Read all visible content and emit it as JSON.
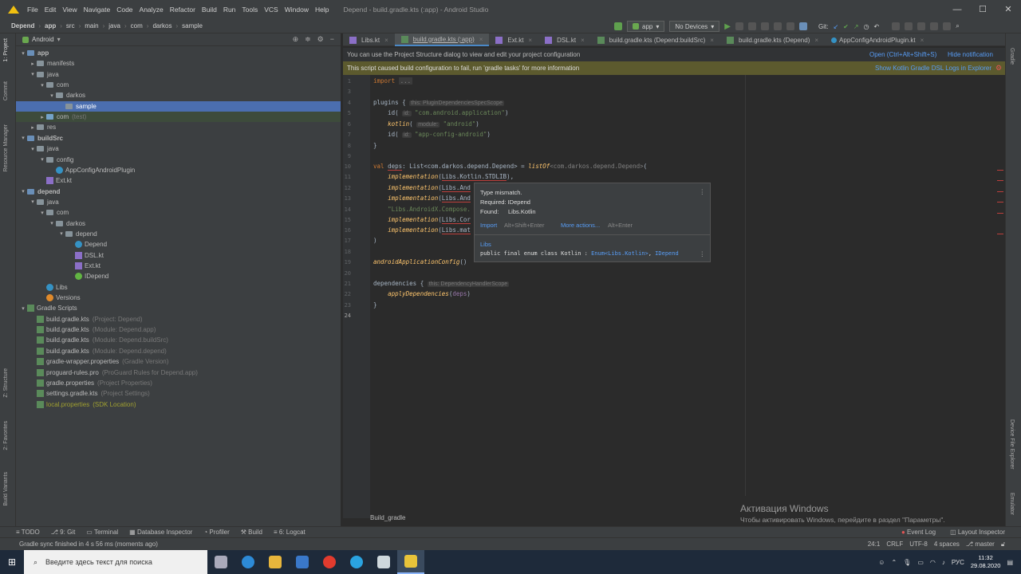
{
  "window": {
    "title": "Depend - build.gradle.kts (:app) - Android Studio",
    "menu": [
      "File",
      "Edit",
      "View",
      "Navigate",
      "Code",
      "Analyze",
      "Refactor",
      "Build",
      "Run",
      "Tools",
      "VCS",
      "Window",
      "Help"
    ],
    "controls": {
      "minimize": "—",
      "maximize": "☐",
      "close": "✕"
    }
  },
  "breadcrumb": [
    "Depend",
    "app",
    "src",
    "main",
    "java",
    "com",
    "darkos",
    "sample"
  ],
  "toolbar": {
    "run_config": "app",
    "device": "No Devices",
    "git_label": "Git:"
  },
  "project_panel": {
    "view_label": "Android",
    "tree": [
      {
        "label": "app",
        "dim": "",
        "kind": "module",
        "bold": true
      },
      {
        "label": "manifests",
        "dim": "",
        "kind": "folder"
      },
      {
        "label": "java",
        "dim": "",
        "kind": "folder"
      },
      {
        "label": "com",
        "dim": "",
        "kind": "folder"
      },
      {
        "label": "darkos",
        "dim": "",
        "kind": "folder"
      },
      {
        "label": "sample",
        "dim": "",
        "kind": "folder"
      },
      {
        "label": "com",
        "dim": "(test)",
        "kind": "folder"
      },
      {
        "label": "res",
        "dim": "",
        "kind": "folder"
      },
      {
        "label": "buildSrc",
        "dim": "",
        "kind": "module",
        "bold": true
      },
      {
        "label": "java",
        "dim": "",
        "kind": "folder"
      },
      {
        "label": "config",
        "dim": "",
        "kind": "folder"
      },
      {
        "label": "AppConfigAndroidPlugin",
        "dim": "",
        "kind": "class"
      },
      {
        "label": "Ext.kt",
        "dim": "",
        "kind": "kt"
      },
      {
        "label": "depend",
        "dim": "",
        "kind": "module",
        "bold": true
      },
      {
        "label": "java",
        "dim": "",
        "kind": "folder"
      },
      {
        "label": "com",
        "dim": "",
        "kind": "folder"
      },
      {
        "label": "darkos",
        "dim": "",
        "kind": "folder"
      },
      {
        "label": "depend",
        "dim": "",
        "kind": "folder"
      },
      {
        "label": "Depend",
        "dim": "",
        "kind": "class"
      },
      {
        "label": "DSL.kt",
        "dim": "",
        "kind": "kt"
      },
      {
        "label": "Ext.kt",
        "dim": "",
        "kind": "kt"
      },
      {
        "label": "IDepend",
        "dim": "",
        "kind": "interface"
      },
      {
        "label": "Libs",
        "dim": "",
        "kind": "class"
      },
      {
        "label": "Versions",
        "dim": "",
        "kind": "object"
      },
      {
        "label": "Gradle Scripts",
        "dim": "",
        "kind": "gradle-root"
      },
      {
        "label": "build.gradle.kts",
        "dim": "(Project: Depend)",
        "kind": "gradle"
      },
      {
        "label": "build.gradle.kts",
        "dim": "(Module: Depend.app)",
        "kind": "gradle"
      },
      {
        "label": "build.gradle.kts",
        "dim": "(Module: Depend.buildSrc)",
        "kind": "gradle"
      },
      {
        "label": "build.gradle.kts",
        "dim": "(Module: Depend.depend)",
        "kind": "gradle"
      },
      {
        "label": "gradle-wrapper.properties",
        "dim": "(Gradle Version)",
        "kind": "gradle"
      },
      {
        "label": "proguard-rules.pro",
        "dim": "(ProGuard Rules for Depend.app)",
        "kind": "gradle"
      },
      {
        "label": "gradle.properties",
        "dim": "(Project Properties)",
        "kind": "gradle"
      },
      {
        "label": "settings.gradle.kts",
        "dim": "(Project Settings)",
        "kind": "gradle"
      },
      {
        "label": "local.properties",
        "dim": "(SDK Location)",
        "kind": "gradle-yellow"
      }
    ]
  },
  "tabs": [
    {
      "label": "Libs.kt"
    },
    {
      "label": "build.gradle.kts (:app)",
      "active": true
    },
    {
      "label": "Ext.kt"
    },
    {
      "label": "DSL.kt"
    },
    {
      "label": "build.gradle.kts (Depend:buildSrc)"
    },
    {
      "label": "build.gradle.kts (Depend)"
    },
    {
      "label": "AppConfigAndroidPlugin.kt"
    }
  ],
  "banners": {
    "structure_text": "You can use the Project Structure dialog to view and edit your project configuration",
    "structure_open": "Open (Ctrl+Alt+Shift+S)",
    "structure_hide": "Hide notification",
    "fail_text": "This script caused build configuration to fail, run 'gradle tasks' for more information",
    "fail_link": "Show Kotlin Gradle DSL Logs in Explorer"
  },
  "editor": {
    "line_numbers": [
      "1",
      "3",
      "4",
      "5",
      "6",
      "7",
      "8",
      "9",
      "10",
      "11",
      "12",
      "13",
      "14",
      "15",
      "16",
      "17",
      "18",
      "19",
      "20",
      "21",
      "22",
      "23",
      "24"
    ],
    "breadcrumb": "Build_gradle"
  },
  "popup": {
    "title": "Type mismatch.",
    "required": "Required: IDepend",
    "found_label": "Found:",
    "found_value": "Libs.Kotlin",
    "import_label": "Import",
    "import_shortcut": "Alt+Shift+Enter",
    "more_label": "More actions...",
    "more_shortcut": "Alt+Enter",
    "decl_owner": "Libs",
    "decl_prefix": "public final enum class Kotlin : ",
    "decl_enum": "Enum<Libs.Kotlin>",
    "decl_sep": ", ",
    "decl_iface": "IDepend"
  },
  "left_strip": [
    "1: Project",
    "Commit",
    "Resource Manager",
    "Z: Structure",
    "2: Favorites",
    "Build Variants"
  ],
  "right_strip": [
    "Gradle",
    "Device File Explorer",
    "Emulator"
  ],
  "bottom_tabs": [
    "TODO",
    "9: Git",
    "Terminal",
    "Database Inspector",
    "Profiler",
    "Build",
    "6: Logcat"
  ],
  "bottom_right": [
    "Event Log",
    "Layout Inspector"
  ],
  "status": {
    "message": "Gradle sync finished in 4 s 56 ms (moments ago)",
    "position": "24:1",
    "line_sep": "CRLF",
    "encoding": "UTF-8",
    "indent": "4 spaces",
    "branch": "master"
  },
  "activation": {
    "title": "Активация Windows",
    "subtitle": "Чтобы активировать Windows, перейдите в раздел \"Параметры\"."
  },
  "taskbar": {
    "search_placeholder": "Введите здесь текст для поиска",
    "lang": "РУС",
    "time": "11:32",
    "date": "29.08.2020"
  }
}
